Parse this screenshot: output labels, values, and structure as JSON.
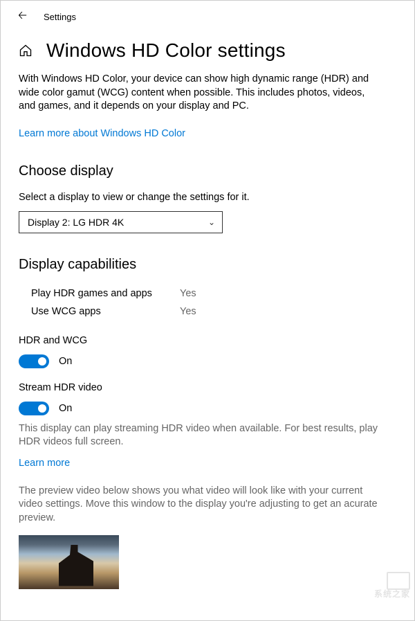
{
  "titlebar": {
    "label": "Settings"
  },
  "header": {
    "title": "Windows HD Color settings"
  },
  "intro": "With Windows HD Color, your device can show high dynamic range (HDR) and wide color gamut (WCG) content when possible. This includes photos, videos, and games, and it depends on your display and PC.",
  "learn_link": "Learn more about Windows HD Color",
  "choose": {
    "heading": "Choose display",
    "text": "Select a display to view or change the settings for it.",
    "selected": "Display 2: LG HDR 4K"
  },
  "capabilities": {
    "heading": "Display capabilities",
    "rows": [
      {
        "label": "Play HDR games and apps",
        "value": "Yes"
      },
      {
        "label": "Use WCG apps",
        "value": "Yes"
      }
    ]
  },
  "hdr_wcg": {
    "label": "HDR and WCG",
    "state": "On"
  },
  "stream": {
    "label": "Stream HDR video",
    "state": "On",
    "note": "This display can play streaming HDR video when available. For best results, play HDR videos full screen.",
    "learn": "Learn more"
  },
  "preview": {
    "text": "The preview video below shows you what video will look like with your current video settings. Move this window to the display you're adjusting to get an acurate preview."
  },
  "watermark": "系统之家"
}
